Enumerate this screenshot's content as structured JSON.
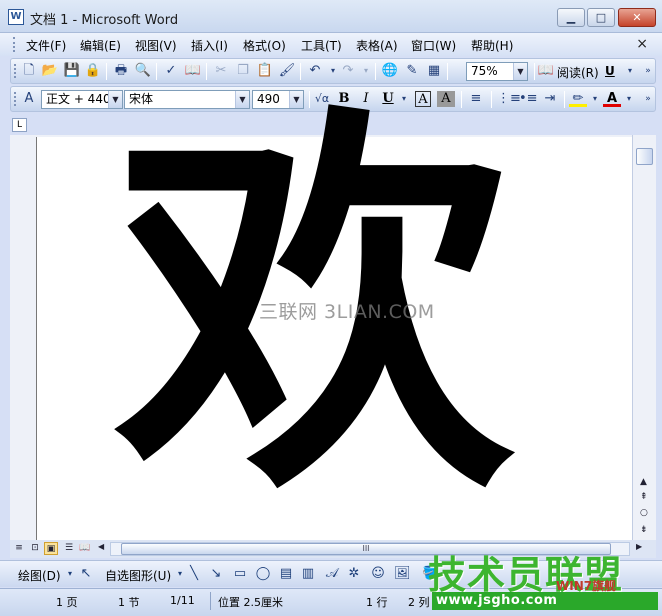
{
  "window": {
    "title": "文档 1 - Microsoft Word",
    "app_icon": "W",
    "min_glyph": "▁",
    "max_glyph": "□",
    "close_glyph": "✕"
  },
  "menubar": {
    "items": [
      "文件(F)",
      "编辑(E)",
      "视图(V)",
      "插入(I)",
      "格式(O)",
      "工具(T)",
      "表格(A)",
      "窗口(W)",
      "帮助(H)"
    ],
    "close_doc": "×"
  },
  "standard_toolbar": {
    "zoom_value": "75%",
    "read_label": "阅读(R)",
    "underline_label": "U"
  },
  "formatting_toolbar": {
    "style_value": "正文 + 440",
    "font_value": "宋体",
    "size_value": "490",
    "bold": "B",
    "italic": "I",
    "underline": "U",
    "char_border": "A",
    "char_shade": "A"
  },
  "ruler": {
    "corner": "L"
  },
  "document": {
    "content_char": "欢",
    "watermark": "三联网 3LIAN.COM"
  },
  "horizontal_scroll": {
    "thumb_grip": "III"
  },
  "drawing_toolbar": {
    "draw_label": "绘图(D)",
    "autoshape_label": "自选图形(U)"
  },
  "statusbar": {
    "page": "1 页",
    "section": "1 节",
    "page_of": "1/11",
    "position": "位置 2.5厘米",
    "line": "1 行",
    "column": "2 列"
  },
  "overlay_watermark": {
    "logo": "技术员联盟",
    "url": "www.jsgho.com",
    "small": "WIN7旗舰"
  }
}
